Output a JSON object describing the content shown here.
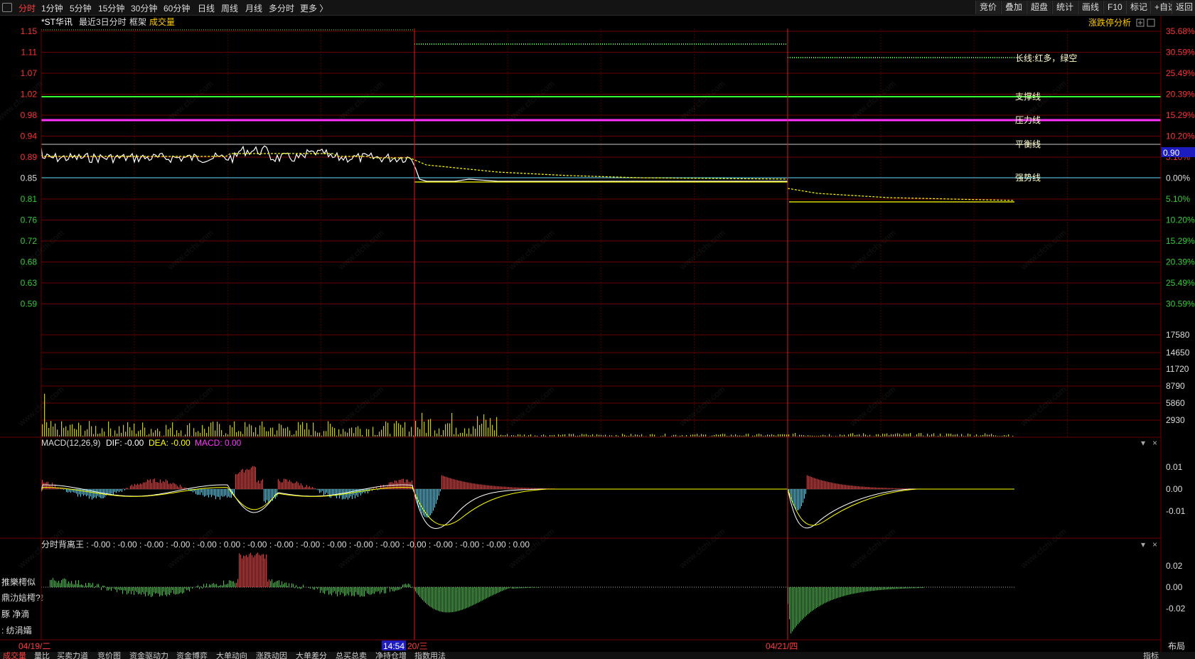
{
  "toolbar": {
    "periods": [
      "分时",
      "1分钟",
      "5分钟",
      "15分钟",
      "30分钟",
      "60分钟",
      "日线",
      "周线",
      "月线",
      "多分时",
      "更多 〉"
    ],
    "right_buttons": [
      "竞价",
      "叠加",
      "超盘",
      "统计",
      "画线",
      "F10",
      "标记",
      "+自选",
      "返回"
    ]
  },
  "header": {
    "stock": "*ST华讯",
    "mode": "最近3日分时",
    "frame": "框架",
    "volume_label": "成交量",
    "limit_analysis": "涨跌停分析"
  },
  "price_axis": {
    "prices": [
      "1.15",
      "1.11",
      "1.07",
      "1.02",
      "0.98",
      "0.94",
      "0.89",
      "0.85",
      "0.81",
      "0.76",
      "0.72",
      "0.68",
      "0.63",
      "0.59"
    ],
    "percents": [
      "35.68%",
      "30.59%",
      "25.49%",
      "20.39%",
      "15.29%",
      "10.20%",
      "5.10%",
      "0.00%",
      "5.10%",
      "10.20%",
      "15.29%",
      "20.39%",
      "25.49%",
      "30.59%"
    ],
    "current_price": "0.90"
  },
  "lines": {
    "long": "长线:红多，绿空",
    "support": "支撑线",
    "pressure": "压力线",
    "balance": "平衡线",
    "strong": "强势线"
  },
  "volume_axis": [
    "17580",
    "14650",
    "11720",
    "8790",
    "5860",
    "2930"
  ],
  "macd": {
    "title": "MACD(12,26,9)",
    "dif": "DIF: -0.00",
    "dea": "DEA: -0.00",
    "macd": "MACD: 0.00",
    "ticks": [
      "0.01",
      "0.00",
      "-0.01"
    ]
  },
  "divergence": {
    "title": "分时背离王 : -0.00 : -0.00 : -0.00 : -0.00 : -0.00 : 0.00 : -0.00 : -0.00 : -0.00 : -0.00 : -0.00 : -0.00 : -0.00 : -0.00 : -0.00 : -0.00 : 0.00",
    "ticks": [
      "0.02",
      "0.00",
      "-0.02"
    ]
  },
  "left_labels": [
    "推樂樗似",
    "鼎氻娮樗?ℓ",
    "豚 净滴",
    ": 纺涓孀"
  ],
  "dates": {
    "d1": "04/19/二",
    "cursor_time": "14:54",
    "d2": "20/三",
    "d3": "04/21/四"
  },
  "bottom_tabs": [
    "成交量",
    "量比",
    "买卖力道",
    "竞价图",
    "资金驱动力",
    "资金博弈",
    "大单动向",
    "涨跌动因",
    "大单差分",
    "总买总卖",
    "净持仓增",
    "指数用法"
  ],
  "bottom_right": [
    "指标",
    "布局"
  ],
  "watermark": "www.cfchi.com",
  "colors": {
    "up": "#ff3333",
    "down": "#33cc33",
    "grid": "#6b0000",
    "support": "#33ff33",
    "pressure": "#ff33ff",
    "yellow": "#ffff00",
    "cyan": "#33e0ff"
  }
}
